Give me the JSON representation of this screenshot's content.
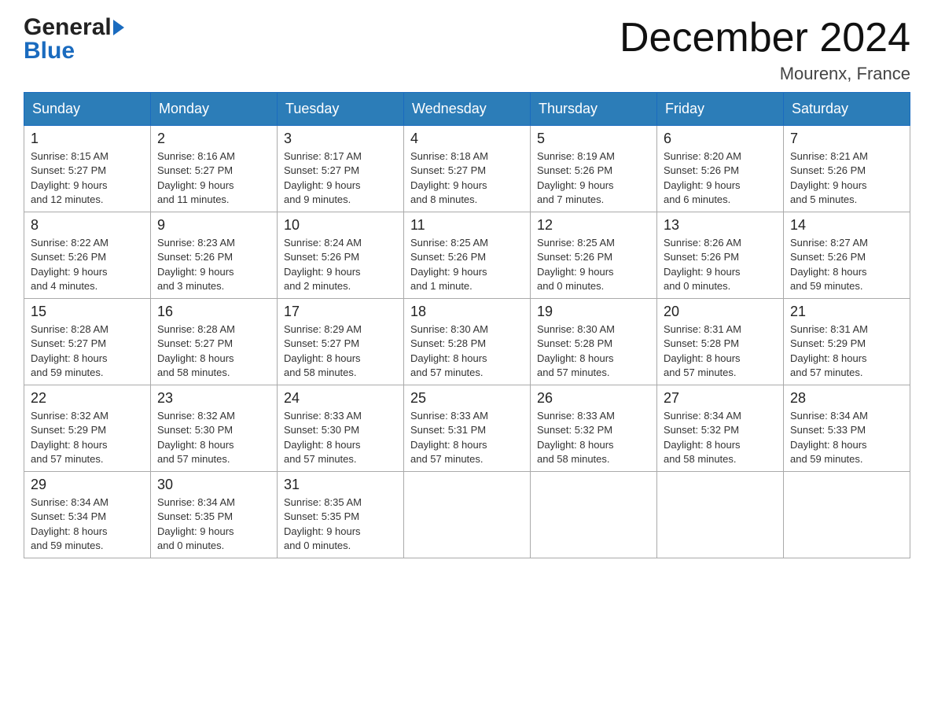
{
  "header": {
    "logo_general": "General",
    "logo_blue": "Blue",
    "month_title": "December 2024",
    "location": "Mourenx, France"
  },
  "days_of_week": [
    "Sunday",
    "Monday",
    "Tuesday",
    "Wednesday",
    "Thursday",
    "Friday",
    "Saturday"
  ],
  "weeks": [
    [
      {
        "day": "1",
        "sunrise": "8:15 AM",
        "sunset": "5:27 PM",
        "daylight": "9 hours and 12 minutes."
      },
      {
        "day": "2",
        "sunrise": "8:16 AM",
        "sunset": "5:27 PM",
        "daylight": "9 hours and 11 minutes."
      },
      {
        "day": "3",
        "sunrise": "8:17 AM",
        "sunset": "5:27 PM",
        "daylight": "9 hours and 9 minutes."
      },
      {
        "day": "4",
        "sunrise": "8:18 AM",
        "sunset": "5:27 PM",
        "daylight": "9 hours and 8 minutes."
      },
      {
        "day": "5",
        "sunrise": "8:19 AM",
        "sunset": "5:26 PM",
        "daylight": "9 hours and 7 minutes."
      },
      {
        "day": "6",
        "sunrise": "8:20 AM",
        "sunset": "5:26 PM",
        "daylight": "9 hours and 6 minutes."
      },
      {
        "day": "7",
        "sunrise": "8:21 AM",
        "sunset": "5:26 PM",
        "daylight": "9 hours and 5 minutes."
      }
    ],
    [
      {
        "day": "8",
        "sunrise": "8:22 AM",
        "sunset": "5:26 PM",
        "daylight": "9 hours and 4 minutes."
      },
      {
        "day": "9",
        "sunrise": "8:23 AM",
        "sunset": "5:26 PM",
        "daylight": "9 hours and 3 minutes."
      },
      {
        "day": "10",
        "sunrise": "8:24 AM",
        "sunset": "5:26 PM",
        "daylight": "9 hours and 2 minutes."
      },
      {
        "day": "11",
        "sunrise": "8:25 AM",
        "sunset": "5:26 PM",
        "daylight": "9 hours and 1 minute."
      },
      {
        "day": "12",
        "sunrise": "8:25 AM",
        "sunset": "5:26 PM",
        "daylight": "9 hours and 0 minutes."
      },
      {
        "day": "13",
        "sunrise": "8:26 AM",
        "sunset": "5:26 PM",
        "daylight": "9 hours and 0 minutes."
      },
      {
        "day": "14",
        "sunrise": "8:27 AM",
        "sunset": "5:26 PM",
        "daylight": "8 hours and 59 minutes."
      }
    ],
    [
      {
        "day": "15",
        "sunrise": "8:28 AM",
        "sunset": "5:27 PM",
        "daylight": "8 hours and 59 minutes."
      },
      {
        "day": "16",
        "sunrise": "8:28 AM",
        "sunset": "5:27 PM",
        "daylight": "8 hours and 58 minutes."
      },
      {
        "day": "17",
        "sunrise": "8:29 AM",
        "sunset": "5:27 PM",
        "daylight": "8 hours and 58 minutes."
      },
      {
        "day": "18",
        "sunrise": "8:30 AM",
        "sunset": "5:28 PM",
        "daylight": "8 hours and 57 minutes."
      },
      {
        "day": "19",
        "sunrise": "8:30 AM",
        "sunset": "5:28 PM",
        "daylight": "8 hours and 57 minutes."
      },
      {
        "day": "20",
        "sunrise": "8:31 AM",
        "sunset": "5:28 PM",
        "daylight": "8 hours and 57 minutes."
      },
      {
        "day": "21",
        "sunrise": "8:31 AM",
        "sunset": "5:29 PM",
        "daylight": "8 hours and 57 minutes."
      }
    ],
    [
      {
        "day": "22",
        "sunrise": "8:32 AM",
        "sunset": "5:29 PM",
        "daylight": "8 hours and 57 minutes."
      },
      {
        "day": "23",
        "sunrise": "8:32 AM",
        "sunset": "5:30 PM",
        "daylight": "8 hours and 57 minutes."
      },
      {
        "day": "24",
        "sunrise": "8:33 AM",
        "sunset": "5:30 PM",
        "daylight": "8 hours and 57 minutes."
      },
      {
        "day": "25",
        "sunrise": "8:33 AM",
        "sunset": "5:31 PM",
        "daylight": "8 hours and 57 minutes."
      },
      {
        "day": "26",
        "sunrise": "8:33 AM",
        "sunset": "5:32 PM",
        "daylight": "8 hours and 58 minutes."
      },
      {
        "day": "27",
        "sunrise": "8:34 AM",
        "sunset": "5:32 PM",
        "daylight": "8 hours and 58 minutes."
      },
      {
        "day": "28",
        "sunrise": "8:34 AM",
        "sunset": "5:33 PM",
        "daylight": "8 hours and 59 minutes."
      }
    ],
    [
      {
        "day": "29",
        "sunrise": "8:34 AM",
        "sunset": "5:34 PM",
        "daylight": "8 hours and 59 minutes."
      },
      {
        "day": "30",
        "sunrise": "8:34 AM",
        "sunset": "5:35 PM",
        "daylight": "9 hours and 0 minutes."
      },
      {
        "day": "31",
        "sunrise": "8:35 AM",
        "sunset": "5:35 PM",
        "daylight": "9 hours and 0 minutes."
      },
      null,
      null,
      null,
      null
    ]
  ],
  "labels": {
    "sunrise": "Sunrise:",
    "sunset": "Sunset:",
    "daylight": "Daylight:"
  }
}
